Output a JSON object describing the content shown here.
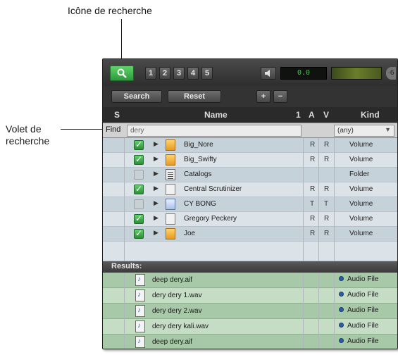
{
  "callouts": {
    "search_icon": "Icône de recherche",
    "search_pane": "Volet de\nrecherche"
  },
  "toolbar": {
    "view_buttons": [
      "1",
      "2",
      "3",
      "4",
      "5"
    ],
    "meter_readout": "0.0",
    "more_glyph": "·6"
  },
  "actions": {
    "search_label": "Search",
    "reset_label": "Reset",
    "plus_label": "+",
    "minus_label": "−"
  },
  "columns": {
    "s": "S",
    "name": "Name",
    "num": "1",
    "a": "A",
    "v": "V",
    "kind": "Kind"
  },
  "find": {
    "label": "Find",
    "value": "dery",
    "kind_selected": "(any)"
  },
  "catalogs": [
    {
      "name": "Big_Nore",
      "a": "R",
      "v": "R",
      "kind": "Volume",
      "checked": true,
      "icon": "volume-icon"
    },
    {
      "name": "Big_Swifty",
      "a": "R",
      "v": "R",
      "kind": "Volume",
      "checked": true,
      "icon": "volume-icon"
    },
    {
      "name": "Catalogs",
      "a": "",
      "v": "",
      "kind": "Folder",
      "checked": false,
      "icon": "folder-icon"
    },
    {
      "name": "Central Scrutinizer",
      "a": "R",
      "v": "R",
      "kind": "Volume",
      "checked": true,
      "icon": "document-icon"
    },
    {
      "name": "CY BONG",
      "a": "T",
      "v": "T",
      "kind": "Volume",
      "checked": false,
      "icon": "cd-icon"
    },
    {
      "name": "Gregory Peckery",
      "a": "R",
      "v": "R",
      "kind": "Volume",
      "checked": true,
      "icon": "document-icon"
    },
    {
      "name": "Joe",
      "a": "R",
      "v": "R",
      "kind": "Volume",
      "checked": true,
      "icon": "volume-icon"
    }
  ],
  "results": {
    "label": "Results:",
    "items": [
      {
        "name": "deep dery.aif",
        "kind": "Audio File"
      },
      {
        "name": "dery dery 1.wav",
        "kind": "Audio File"
      },
      {
        "name": "dery dery 2.wav",
        "kind": "Audio File"
      },
      {
        "name": "dery dery kali.wav",
        "kind": "Audio File"
      },
      {
        "name": "deep dery.aif",
        "kind": "Audio File"
      }
    ]
  },
  "colors": {
    "accent_green": "#3ab048",
    "catalog_row": "#c5d2da",
    "result_row": "#a8c9a8"
  }
}
